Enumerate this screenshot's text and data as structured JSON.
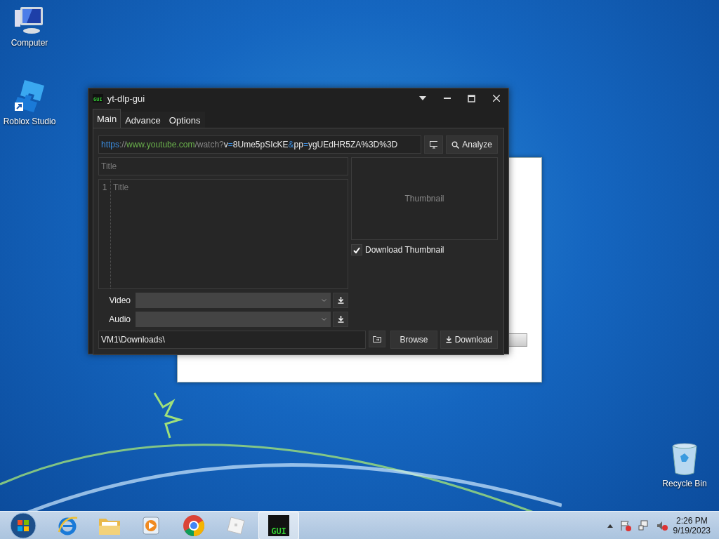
{
  "desktop_icons": [
    {
      "label": "Computer",
      "kind": "computer"
    },
    {
      "label": "Roblox Studio",
      "kind": "roblox"
    },
    {
      "label": "Recycle Bin",
      "kind": "bin"
    }
  ],
  "window": {
    "title": "yt-dlp-gui",
    "icon_text": "GUI",
    "tabs": [
      {
        "label": "Main",
        "selected": true
      },
      {
        "label": "Advance",
        "selected": false
      },
      {
        "label": "Options",
        "selected": false
      }
    ],
    "url": [
      {
        "text": "https",
        "kind": "scheme"
      },
      {
        "text": "://",
        "kind": "punct"
      },
      {
        "text": "www.youtube.com",
        "kind": "host"
      },
      {
        "text": "/watch?",
        "kind": "punct"
      },
      {
        "text": "v",
        "kind": "plain"
      },
      {
        "text": "=",
        "kind": "scheme"
      },
      {
        "text": "8Ume5pSIcKE",
        "kind": "plain"
      },
      {
        "text": "&",
        "kind": "scheme"
      },
      {
        "text": "pp",
        "kind": "plain"
      },
      {
        "text": "=",
        "kind": "scheme"
      },
      {
        "text": "ygUEdHR5ZA%3D%3D",
        "kind": "plain"
      }
    ],
    "analyze_button": "Analyze",
    "title_field": {
      "placeholder": "Title"
    },
    "description": {
      "line_number": "1",
      "placeholder": "Title"
    },
    "thumbnail": "Thumbnail",
    "download_thumbnail": {
      "label": "Download Thumbnail",
      "checked": true
    },
    "formats": [
      {
        "label": "Video"
      },
      {
        "label": "Audio"
      }
    ],
    "path": "VM1\\Downloads\\",
    "browse_button": "Browse",
    "download_button": "Download"
  },
  "taskbar": {
    "apps": [
      {
        "kind": "ie",
        "selected": false
      },
      {
        "kind": "explorer",
        "selected": false
      },
      {
        "kind": "media",
        "selected": false
      },
      {
        "kind": "chrome",
        "selected": false
      },
      {
        "kind": "roblox",
        "selected": false
      },
      {
        "kind": "ytdlp",
        "selected": true,
        "text": "GUI"
      }
    ],
    "time": "2:26 PM",
    "date": "9/19/2023"
  }
}
